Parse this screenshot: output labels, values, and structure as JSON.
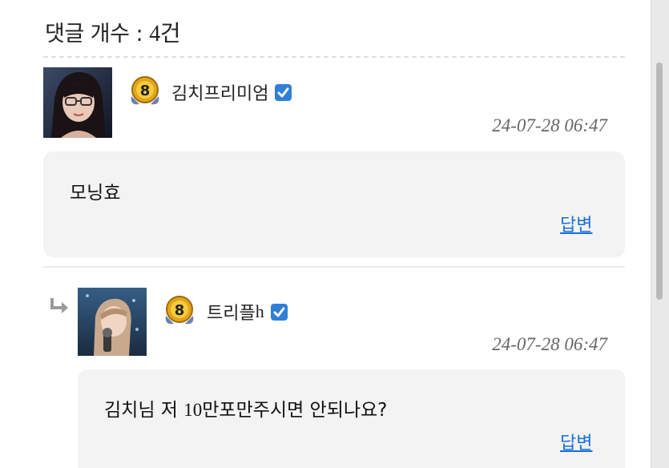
{
  "header": {
    "count_label": "댓글 개수 : ",
    "count_value": "4건"
  },
  "comments": [
    {
      "username": "김치프리미엄",
      "badge_level": "8",
      "verified": true,
      "date": "24-07-28 06:47",
      "body": "모닝효",
      "reply_label": "답변",
      "is_reply": false
    },
    {
      "username_ko": "트리플",
      "username_latin": "h",
      "badge_level": "8",
      "verified": true,
      "date": "24-07-28 06:47",
      "body_ko_1": "김치님 저 ",
      "body_num": "10",
      "body_ko_2": "만포만주시면 안되나요?",
      "reply_label": "답변",
      "is_reply": true
    }
  ],
  "colors": {
    "link": "#1a6fd6",
    "bubble_bg": "#f3f3f3",
    "verified": "#2f7fd8",
    "badge_gold": "#e3a51a"
  },
  "icons": [
    "verified-check-icon",
    "level-badge-icon",
    "reply-arrow-icon"
  ]
}
